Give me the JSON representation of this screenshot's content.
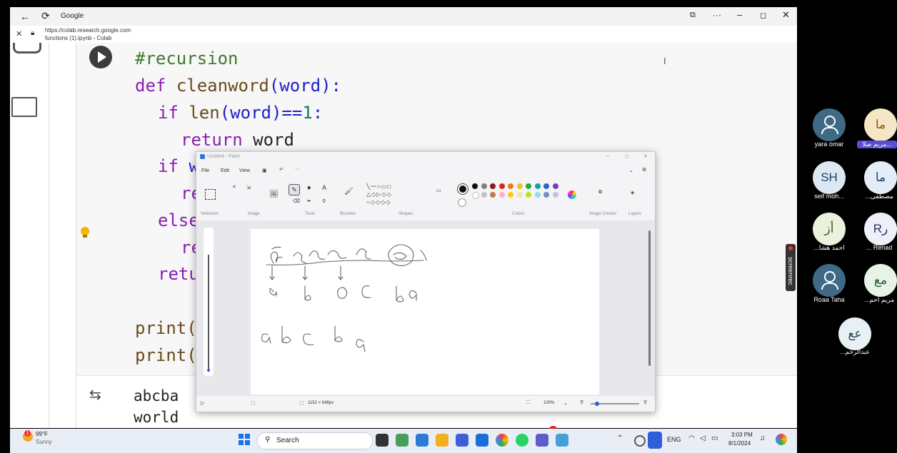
{
  "browser": {
    "tab_title": "Google",
    "url": "https://colab.research.google.com",
    "page_title": "functions (1).ipynb - Colab"
  },
  "code": {
    "line1": "#recursion",
    "line2_def": "def",
    "line2_name": "cleanword",
    "line2_args": "(word):",
    "line3_if": "if",
    "line3_len": "len",
    "line3_rest": "(word)==",
    "line3_num": "1",
    "line3_colon": ":",
    "line4_return": "return",
    "line4_word": "word",
    "line5_if": "if",
    "line5_frag": "w",
    "line6_frag": "re",
    "line7_frag": "else",
    "line8_frag": "re",
    "line9_frag": "retu",
    "line10_frag": "print(",
    "line11_frag": "print("
  },
  "output": {
    "line1": "abcba",
    "line2": "world"
  },
  "paint": {
    "title": "Untitled - Paint",
    "menu": [
      "File",
      "Edit",
      "View"
    ],
    "groups": [
      "Selection",
      "Image",
      "Tools",
      "Brushes",
      "Shapes",
      "Colors",
      "Image Creator",
      "Layers"
    ],
    "canvas_size": "1152 × 648px",
    "zoom": "100%",
    "colors_row1": [
      "#111111",
      "#7f7f7f",
      "#8b1a1a",
      "#e02020",
      "#f07b1e",
      "#f2c21b",
      "#27a83a",
      "#16a0a8",
      "#2f5fd6",
      "#7a3bc2"
    ],
    "colors_row2": [
      "#ffffff",
      "#c3c3c3",
      "#b97a57",
      "#ffaec9",
      "#ffc90e",
      "#efe4b0",
      "#b5e61d",
      "#99d9ea",
      "#7092be",
      "#c8bfe7"
    ]
  },
  "screenrec_label": "screenrec",
  "participants": [
    {
      "initials": "",
      "name": "yara omar",
      "color": "#3e6a86"
    },
    {
      "initials": "ما",
      "name": "مريم صلا...",
      "color": "#f5e6c6"
    },
    {
      "initials": "SH",
      "name": "seif moh...",
      "color": "#dde8f4"
    },
    {
      "initials": "ما",
      "name": "...مصطفى",
      "color": "#e4ecf7"
    },
    {
      "initials": "أز",
      "name": "...احمد هشا",
      "color": "#eaf1dc"
    },
    {
      "initials": "Rر",
      "name": "... Renad",
      "color": "#eef0f7"
    },
    {
      "initials": "",
      "name": "Roaa Taha",
      "color": "#3e6a86"
    },
    {
      "initials": "مع",
      "name": "...مريم احم",
      "color": "#e6f3e6"
    },
    {
      "initials": "عع",
      "name": "...عبدالرحم",
      "color": "#e8f0f4"
    }
  ],
  "taskbar": {
    "weather_temp": "99°F",
    "weather_cond": "Sunny",
    "search_label": "Search",
    "lang": "ENG",
    "time": "3:03 PM",
    "date": "8/1/2024",
    "notification_count": "1"
  }
}
